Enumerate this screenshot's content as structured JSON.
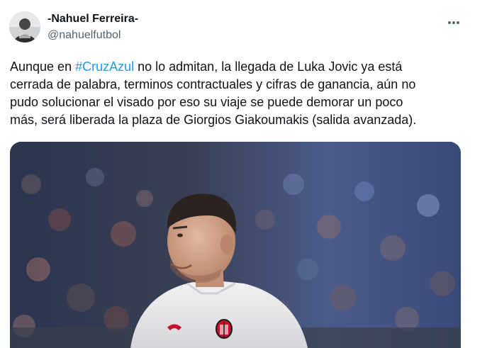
{
  "author": {
    "display_name": "-Nahuel Ferreira-",
    "handle": "@nahuelfutbol",
    "avatar_icon": "user-avatar"
  },
  "more_icon": "more-options-icon",
  "tweet": {
    "line1_before": "Aunque en ",
    "hashtag": "#CruzAzul",
    "line1_after": " no lo admitan, la llegada de Luka Jovic ya está",
    "line2": "cerrada de palabra, terminos contractuales y cifras de ganancia, aún no",
    "line3": "pudo solucionar el visado por eso su viaje se puede demorar un poco",
    "line4": "más, será liberada la plaza de Giorgios Giakoumakis (salida avanzada)."
  },
  "media": {
    "kind": "photo",
    "colors": {
      "background_blue": "#3c4f7a",
      "jersey": "#e9e9ec",
      "crest_red": "#c8102e"
    }
  },
  "colors": {
    "text": "#0f1419",
    "secondary": "#536471",
    "link": "#1d9bf0"
  }
}
